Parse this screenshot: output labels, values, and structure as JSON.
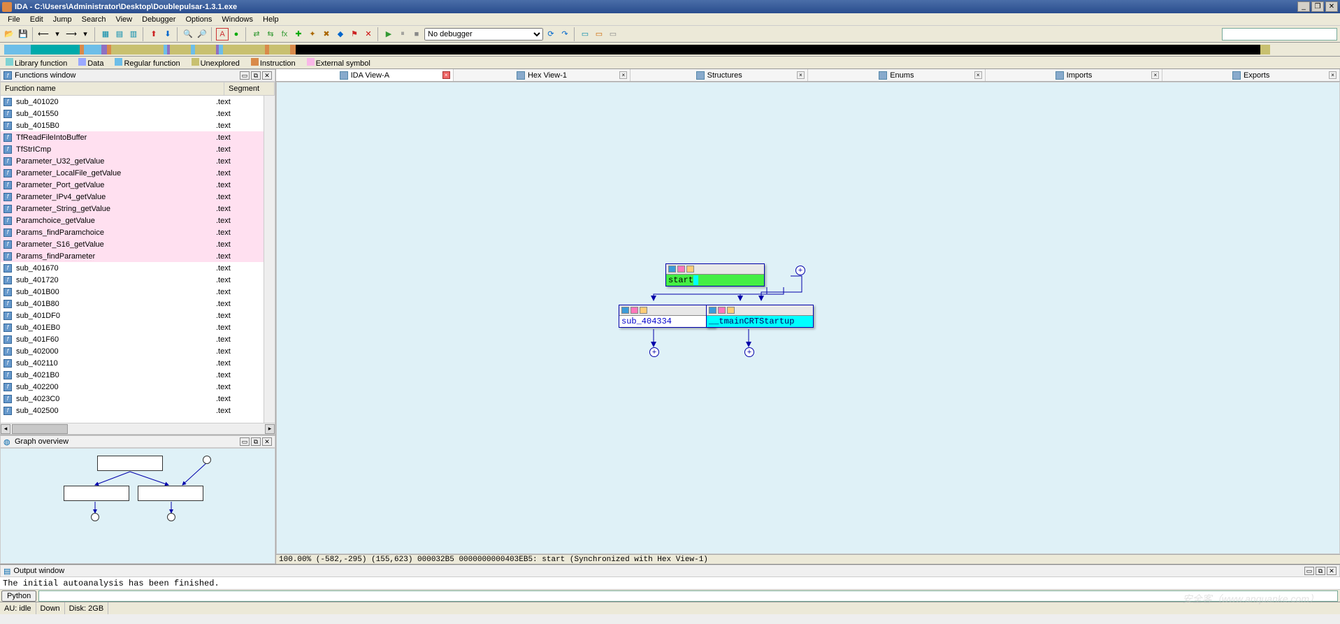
{
  "title": "IDA - C:\\Users\\Administrator\\Desktop\\Doublepulsar-1.3.1.exe",
  "menus": [
    "File",
    "Edit",
    "Jump",
    "Search",
    "View",
    "Debugger",
    "Options",
    "Windows",
    "Help"
  ],
  "debugger_select": "No debugger",
  "legend": [
    {
      "color": "#7fd3d3",
      "label": "Library function"
    },
    {
      "color": "#9aa9ff",
      "label": "Data"
    },
    {
      "color": "#6dbee8",
      "label": "Regular function"
    },
    {
      "color": "#c8c070",
      "label": "Unexplored"
    },
    {
      "color": "#d98a4a",
      "label": "Instruction"
    },
    {
      "color": "#f9b7e8",
      "label": "External symbol"
    }
  ],
  "functions_window": {
    "title": "Functions window",
    "columns": [
      "Function name",
      "Segment"
    ],
    "rows": [
      {
        "name": "sub_401020",
        "seg": ".text",
        "hl": false
      },
      {
        "name": "sub_401550",
        "seg": ".text",
        "hl": false
      },
      {
        "name": "sub_4015B0",
        "seg": ".text",
        "hl": false
      },
      {
        "name": "TfReadFileIntoBuffer",
        "seg": ".text",
        "hl": true
      },
      {
        "name": "TfStrICmp",
        "seg": ".text",
        "hl": true
      },
      {
        "name": "Parameter_U32_getValue",
        "seg": ".text",
        "hl": true
      },
      {
        "name": "Parameter_LocalFile_getValue",
        "seg": ".text",
        "hl": true
      },
      {
        "name": "Parameter_Port_getValue",
        "seg": ".text",
        "hl": true
      },
      {
        "name": "Parameter_IPv4_getValue",
        "seg": ".text",
        "hl": true
      },
      {
        "name": "Parameter_String_getValue",
        "seg": ".text",
        "hl": true
      },
      {
        "name": "Paramchoice_getValue",
        "seg": ".text",
        "hl": true
      },
      {
        "name": "Params_findParamchoice",
        "seg": ".text",
        "hl": true
      },
      {
        "name": "Parameter_S16_getValue",
        "seg": ".text",
        "hl": true
      },
      {
        "name": "Params_findParameter",
        "seg": ".text",
        "hl": true
      },
      {
        "name": "sub_401670",
        "seg": ".text",
        "hl": false
      },
      {
        "name": "sub_401720",
        "seg": ".text",
        "hl": false
      },
      {
        "name": "sub_401B00",
        "seg": ".text",
        "hl": false
      },
      {
        "name": "sub_401B80",
        "seg": ".text",
        "hl": false
      },
      {
        "name": "sub_401DF0",
        "seg": ".text",
        "hl": false
      },
      {
        "name": "sub_401EB0",
        "seg": ".text",
        "hl": false
      },
      {
        "name": "sub_401F60",
        "seg": ".text",
        "hl": false
      },
      {
        "name": "sub_402000",
        "seg": ".text",
        "hl": false
      },
      {
        "name": "sub_402110",
        "seg": ".text",
        "hl": false
      },
      {
        "name": "sub_4021B0",
        "seg": ".text",
        "hl": false
      },
      {
        "name": "sub_402200",
        "seg": ".text",
        "hl": false
      },
      {
        "name": "sub_4023C0",
        "seg": ".text",
        "hl": false
      },
      {
        "name": "sub_402500",
        "seg": ".text",
        "hl": false
      }
    ]
  },
  "graph_overview_title": "Graph overview",
  "tabs": [
    {
      "label": "IDA View-A",
      "active": true
    },
    {
      "label": "Hex View-1",
      "active": false
    },
    {
      "label": "Structures",
      "active": false
    },
    {
      "label": "Enums",
      "active": false
    },
    {
      "label": "Imports",
      "active": false
    },
    {
      "label": "Exports",
      "active": false
    }
  ],
  "graph_nodes": {
    "start": "start",
    "sub1": "sub_404334",
    "sub2": "__tmainCRTStartup"
  },
  "status_line": "100.00% (-582,-295) (155,623) 000032B5 0000000000403EB5: start (Synchronized with Hex View-1)",
  "output_window_title": "Output window",
  "output_text": "The initial autoanalysis has been finished.",
  "python_label": "Python",
  "status_bottom": {
    "au": "AU: idle",
    "down": "Down",
    "disk": "Disk: 2GB"
  },
  "watermark": "安全客（www.anquanke.com）"
}
